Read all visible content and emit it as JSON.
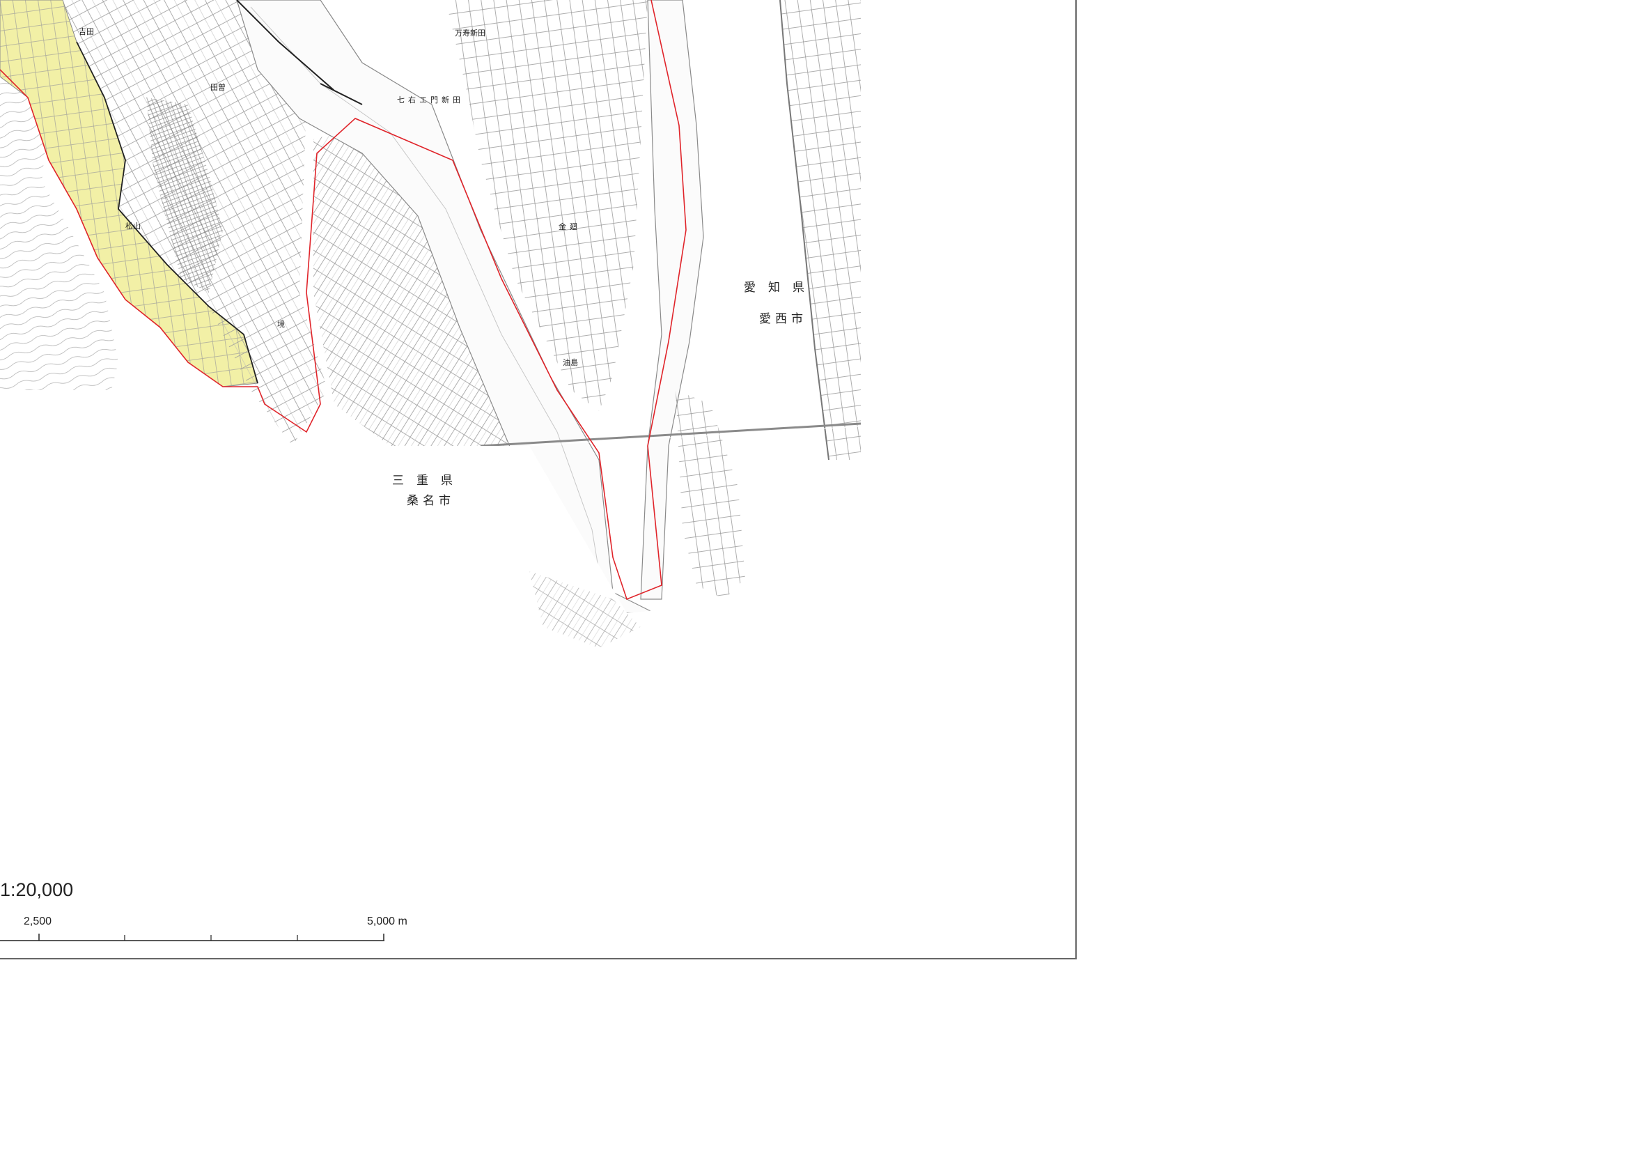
{
  "map": {
    "place_labels": {
      "yoshida": "吉田",
      "tadeso": "田曽",
      "matsuyama": "松山",
      "kyo": "境",
      "shichiemon_shinden": "七右エ門新田",
      "manju_shinden": "万寿新田",
      "kinsei": "金廻",
      "aburajima": "油島"
    },
    "prefecture_mie": "三重県",
    "city_kuwana": "桑名市",
    "prefecture_aichi": "愛知県",
    "city_aisai": "愛西市",
    "colors": {
      "boundary_red": "#e0242a",
      "highlight_yellow": "#f2f0a6",
      "line_gray": "#8a8a8a",
      "border_black": "#222222"
    }
  },
  "scale": {
    "ratio": "1:20,000",
    "label_mid": "2,500",
    "label_end": "5,000 m"
  }
}
